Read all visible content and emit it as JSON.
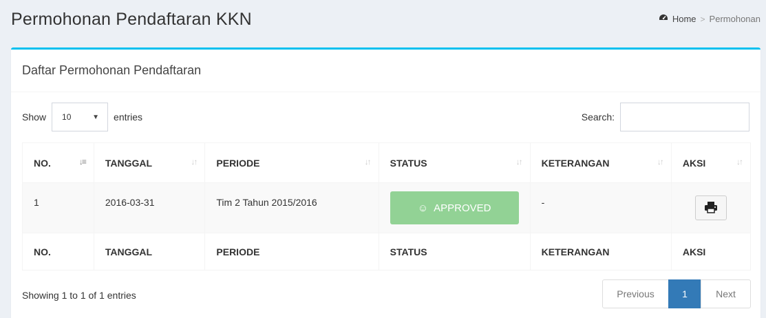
{
  "header": {
    "title": "Permohonan Pendaftaran KKN",
    "breadcrumb": {
      "home_icon": "dashboard-icon",
      "home": "Home",
      "separator": ">",
      "current": "Permohonan"
    }
  },
  "box": {
    "title": "Daftar Permohonan Pendaftaran",
    "accent_color": "#00c0ef"
  },
  "length": {
    "label_before": "Show",
    "value": "10",
    "label_after": "entries"
  },
  "search": {
    "label": "Search:",
    "value": ""
  },
  "table": {
    "columns": [
      "NO.",
      "TANGGAL",
      "PERIODE",
      "STATUS",
      "KETERANGAN",
      "AKSI"
    ],
    "rows": [
      {
        "no": "1",
        "tanggal": "2016-03-31",
        "periode": "Tim 2 Tahun 2015/2016",
        "status": "APPROVED",
        "keterangan": "-",
        "aksi_icon": "print-icon"
      }
    ]
  },
  "footer": {
    "info": "Showing 1 to 1 of 1 entries",
    "pagination": {
      "previous": "Previous",
      "current": "1",
      "next": "Next"
    }
  },
  "colors": {
    "approved": "#92d295",
    "page_active": "#337ab7"
  }
}
